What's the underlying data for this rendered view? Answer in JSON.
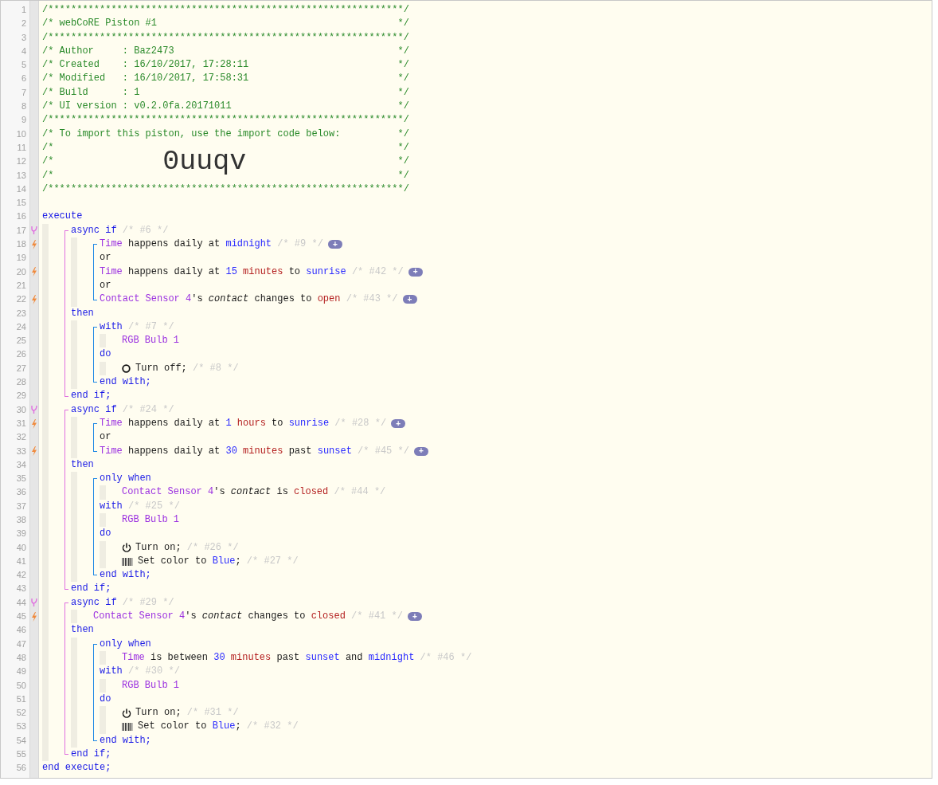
{
  "listing": [
    {
      "kind": "rule",
      "number": "1",
      "text": "/**************************************************************/"
    },
    {
      "kind": "comment",
      "number": "2",
      "text": "/* webCoRE Piston #1",
      "end": "*/"
    },
    {
      "kind": "rule",
      "number": "3",
      "text": "/**************************************************************/"
    },
    {
      "kind": "comment",
      "number": "4",
      "text": "/* Author     : Baz2473",
      "end": "*/"
    },
    {
      "kind": "comment",
      "number": "5",
      "text": "/* Created    : 16/10/2017, 17:28:11",
      "end": "*/"
    },
    {
      "kind": "comment",
      "number": "6",
      "text": "/* Modified   : 16/10/2017, 17:58:31",
      "end": "*/"
    },
    {
      "kind": "comment",
      "number": "7",
      "text": "/* Build      : 1",
      "end": "*/"
    },
    {
      "kind": "comment",
      "number": "8",
      "text": "/* UI version : v0.2.0fa.20171011",
      "end": "*/"
    },
    {
      "kind": "rule",
      "number": "9",
      "text": "/**************************************************************/"
    },
    {
      "kind": "comment",
      "number": "10",
      "text": "/* To import this piston, use the import code below:",
      "end": "*/"
    },
    {
      "kind": "import",
      "numbers": [
        "11",
        "12",
        "13"
      ],
      "left": [
        "/*",
        "/*",
        "/*"
      ],
      "right": [
        "*/",
        "*/",
        "*/"
      ],
      "code": "0uuqv"
    },
    {
      "kind": "rule",
      "number": "14",
      "text": "/**************************************************************/"
    },
    {
      "kind": "line",
      "number": "15"
    },
    {
      "kind": "line",
      "number": "16",
      "tokens": [
        {
          "kind": "keyword",
          "text": "execute"
        }
      ]
    },
    {
      "kind": "indent",
      "items": [
        {
          "kind": "if_block",
          "items": [
            {
              "kind": "branch",
              "number": "17",
              "tokens": [
                {
                  "kind": "keyword",
                  "text": "async if "
                },
                {
                  "kind": "note",
                  "text": "/* #6 */"
                }
              ]
            },
            {
              "kind": "indent",
              "items": [
                {
                  "kind": "list_block",
                  "items": [
                    {
                      "kind": "trigger",
                      "number": "18",
                      "tokens": [
                        {
                          "kind": "device",
                          "text": "Time"
                        },
                        {
                          "kind": "plain",
                          "text": " happens daily at "
                        },
                        {
                          "kind": "constant",
                          "text": "midnight "
                        },
                        {
                          "kind": "note",
                          "text": "/* #9 */"
                        },
                        {
                          "kind": "add",
                          "text": "+"
                        }
                      ]
                    },
                    {
                      "kind": "line",
                      "number": "19",
                      "tokens": [
                        {
                          "kind": "plain",
                          "text": "or"
                        }
                      ]
                    },
                    {
                      "kind": "trigger",
                      "number": "20",
                      "tokens": [
                        {
                          "kind": "device",
                          "text": "Time"
                        },
                        {
                          "kind": "plain",
                          "text": " happens daily at "
                        },
                        {
                          "kind": "number",
                          "text": "15 "
                        },
                        {
                          "kind": "unit",
                          "text": "minutes"
                        },
                        {
                          "kind": "plain",
                          "text": " to "
                        },
                        {
                          "kind": "constant",
                          "text": "sunrise "
                        },
                        {
                          "kind": "note",
                          "text": "/* #42 */"
                        },
                        {
                          "kind": "add",
                          "text": "+"
                        }
                      ]
                    },
                    {
                      "kind": "line",
                      "number": "21",
                      "tokens": [
                        {
                          "kind": "plain",
                          "text": "or"
                        }
                      ]
                    },
                    {
                      "kind": "trigger",
                      "number": "22",
                      "tokens": [
                        {
                          "kind": "device",
                          "text": "Contact Sensor 4"
                        },
                        {
                          "kind": "plain",
                          "text": "'s "
                        },
                        {
                          "kind": "attribute",
                          "text": "contact"
                        },
                        {
                          "kind": "plain",
                          "text": " changes to "
                        },
                        {
                          "kind": "state",
                          "text": "open "
                        },
                        {
                          "kind": "note",
                          "text": "/* #43 */"
                        },
                        {
                          "kind": "add",
                          "text": "+"
                        }
                      ]
                    }
                  ]
                }
              ]
            },
            {
              "kind": "line",
              "number": "23",
              "tokens": [
                {
                  "kind": "keyword",
                  "text": "then"
                }
              ]
            },
            {
              "kind": "indent",
              "items": [
                {
                  "kind": "list_block",
                  "items": [
                    {
                      "kind": "line",
                      "number": "24",
                      "tokens": [
                        {
                          "kind": "keyword",
                          "text": "with "
                        },
                        {
                          "kind": "note",
                          "text": "/* #7 */"
                        }
                      ]
                    },
                    {
                      "kind": "indent",
                      "items": [
                        {
                          "kind": "line",
                          "number": "25",
                          "tokens": [
                            {
                              "kind": "device",
                              "text": "RGB Bulb 1"
                            }
                          ]
                        }
                      ]
                    },
                    {
                      "kind": "line",
                      "number": "26",
                      "tokens": [
                        {
                          "kind": "keyword",
                          "text": "do"
                        }
                      ]
                    },
                    {
                      "kind": "indent",
                      "items": [
                        {
                          "kind": "line",
                          "number": "27",
                          "tokens": [
                            {
                              "kind": "off_icon"
                            },
                            {
                              "kind": "plain",
                              "text": "Turn off; "
                            },
                            {
                              "kind": "note",
                              "text": "/* #8 */"
                            }
                          ]
                        }
                      ]
                    },
                    {
                      "kind": "line",
                      "number": "28",
                      "tokens": [
                        {
                          "kind": "keyword",
                          "text": "end with;"
                        }
                      ]
                    }
                  ]
                }
              ]
            },
            {
              "kind": "line",
              "number": "29",
              "tokens": [
                {
                  "kind": "keyword",
                  "text": "end if;"
                }
              ]
            }
          ]
        },
        {
          "kind": "if_block",
          "items": [
            {
              "kind": "branch",
              "number": "30",
              "tokens": [
                {
                  "kind": "keyword",
                  "text": "async if "
                },
                {
                  "kind": "note",
                  "text": "/* #24 */"
                }
              ]
            },
            {
              "kind": "indent",
              "items": [
                {
                  "kind": "list_block",
                  "items": [
                    {
                      "kind": "trigger",
                      "number": "31",
                      "tokens": [
                        {
                          "kind": "device",
                          "text": "Time"
                        },
                        {
                          "kind": "plain",
                          "text": " happens daily at "
                        },
                        {
                          "kind": "number",
                          "text": "1 "
                        },
                        {
                          "kind": "unit",
                          "text": "hours"
                        },
                        {
                          "kind": "plain",
                          "text": " to "
                        },
                        {
                          "kind": "constant",
                          "text": "sunrise "
                        },
                        {
                          "kind": "note",
                          "text": "/* #28 */"
                        },
                        {
                          "kind": "add",
                          "text": "+"
                        }
                      ]
                    },
                    {
                      "kind": "line",
                      "number": "32",
                      "tokens": [
                        {
                          "kind": "plain",
                          "text": "or"
                        }
                      ]
                    },
                    {
                      "kind": "trigger",
                      "number": "33",
                      "tokens": [
                        {
                          "kind": "device",
                          "text": "Time"
                        },
                        {
                          "kind": "plain",
                          "text": " happens daily at "
                        },
                        {
                          "kind": "number",
                          "text": "30 "
                        },
                        {
                          "kind": "unit",
                          "text": "minutes"
                        },
                        {
                          "kind": "plain",
                          "text": " past "
                        },
                        {
                          "kind": "constant",
                          "text": "sunset "
                        },
                        {
                          "kind": "note",
                          "text": "/* #45 */"
                        },
                        {
                          "kind": "add",
                          "text": "+"
                        }
                      ]
                    }
                  ]
                }
              ]
            },
            {
              "kind": "line",
              "number": "34",
              "tokens": [
                {
                  "kind": "keyword",
                  "text": "then"
                }
              ]
            },
            {
              "kind": "indent",
              "items": [
                {
                  "kind": "list_block",
                  "items": [
                    {
                      "kind": "line",
                      "number": "35",
                      "tokens": [
                        {
                          "kind": "keyword",
                          "text": "only when"
                        }
                      ]
                    },
                    {
                      "kind": "indent",
                      "items": [
                        {
                          "kind": "line",
                          "number": "36",
                          "tokens": [
                            {
                              "kind": "device",
                              "text": "Contact Sensor 4"
                            },
                            {
                              "kind": "plain",
                              "text": "'s "
                            },
                            {
                              "kind": "attribute",
                              "text": "contact"
                            },
                            {
                              "kind": "plain",
                              "text": " is "
                            },
                            {
                              "kind": "state",
                              "text": "closed "
                            },
                            {
                              "kind": "note",
                              "text": "/* #44 */"
                            }
                          ]
                        }
                      ]
                    },
                    {
                      "kind": "line",
                      "number": "37",
                      "tokens": [
                        {
                          "kind": "keyword",
                          "text": "with "
                        },
                        {
                          "kind": "note",
                          "text": "/* #25 */"
                        }
                      ]
                    },
                    {
                      "kind": "indent",
                      "items": [
                        {
                          "kind": "line",
                          "number": "38",
                          "tokens": [
                            {
                              "kind": "device",
                              "text": "RGB Bulb 1"
                            }
                          ]
                        }
                      ]
                    },
                    {
                      "kind": "line",
                      "number": "39",
                      "tokens": [
                        {
                          "kind": "keyword",
                          "text": "do"
                        }
                      ]
                    },
                    {
                      "kind": "indent",
                      "items": [
                        {
                          "kind": "line",
                          "number": "40",
                          "tokens": [
                            {
                              "kind": "on_icon"
                            },
                            {
                              "kind": "plain",
                              "text": "Turn on; "
                            },
                            {
                              "kind": "note",
                              "text": "/* #26 */"
                            }
                          ]
                        },
                        {
                          "kind": "line",
                          "number": "41",
                          "tokens": [
                            {
                              "kind": "color_icon"
                            },
                            {
                              "kind": "plain",
                              "text": "Set color to "
                            },
                            {
                              "kind": "constant",
                              "text": "Blue"
                            },
                            {
                              "kind": "plain",
                              "text": "; "
                            },
                            {
                              "kind": "note",
                              "text": "/* #27 */"
                            }
                          ]
                        }
                      ]
                    },
                    {
                      "kind": "line",
                      "number": "42",
                      "tokens": [
                        {
                          "kind": "keyword",
                          "text": "end with;"
                        }
                      ]
                    }
                  ]
                }
              ]
            },
            {
              "kind": "line",
              "number": "43",
              "tokens": [
                {
                  "kind": "keyword",
                  "text": "end if;"
                }
              ]
            }
          ]
        },
        {
          "kind": "if_block",
          "items": [
            {
              "kind": "branch",
              "number": "44",
              "tokens": [
                {
                  "kind": "keyword",
                  "text": "async if "
                },
                {
                  "kind": "note",
                  "text": "/* #29 */"
                }
              ]
            },
            {
              "kind": "indent",
              "items": [
                {
                  "kind": "trigger",
                  "number": "45",
                  "tokens": [
                    {
                      "kind": "device",
                      "text": "Contact Sensor 4"
                    },
                    {
                      "kind": "plain",
                      "text": "'s "
                    },
                    {
                      "kind": "attribute",
                      "text": "contact"
                    },
                    {
                      "kind": "plain",
                      "text": " changes to "
                    },
                    {
                      "kind": "state",
                      "text": "closed "
                    },
                    {
                      "kind": "note",
                      "text": "/* #41 */"
                    },
                    {
                      "kind": "add",
                      "text": "+"
                    }
                  ]
                }
              ]
            },
            {
              "kind": "line",
              "number": "46",
              "tokens": [
                {
                  "kind": "keyword",
                  "text": "then"
                }
              ]
            },
            {
              "kind": "indent",
              "items": [
                {
                  "kind": "list_block",
                  "items": [
                    {
                      "kind": "line",
                      "number": "47",
                      "tokens": [
                        {
                          "kind": "keyword",
                          "text": "only when"
                        }
                      ]
                    },
                    {
                      "kind": "indent",
                      "items": [
                        {
                          "kind": "line",
                          "number": "48",
                          "tokens": [
                            {
                              "kind": "device",
                              "text": "Time"
                            },
                            {
                              "kind": "plain",
                              "text": " is between "
                            },
                            {
                              "kind": "number",
                              "text": "30 "
                            },
                            {
                              "kind": "unit",
                              "text": "minutes"
                            },
                            {
                              "kind": "plain",
                              "text": " past "
                            },
                            {
                              "kind": "constant",
                              "text": "sunset"
                            },
                            {
                              "kind": "plain",
                              "text": " and "
                            },
                            {
                              "kind": "constant",
                              "text": "midnight "
                            },
                            {
                              "kind": "note",
                              "text": "/* #46 */"
                            }
                          ]
                        }
                      ]
                    },
                    {
                      "kind": "line",
                      "number": "49",
                      "tokens": [
                        {
                          "kind": "keyword",
                          "text": "with "
                        },
                        {
                          "kind": "note",
                          "text": "/* #30 */"
                        }
                      ]
                    },
                    {
                      "kind": "indent",
                      "items": [
                        {
                          "kind": "line",
                          "number": "50",
                          "tokens": [
                            {
                              "kind": "device",
                              "text": "RGB Bulb 1"
                            }
                          ]
                        }
                      ]
                    },
                    {
                      "kind": "line",
                      "number": "51",
                      "tokens": [
                        {
                          "kind": "keyword",
                          "text": "do"
                        }
                      ]
                    },
                    {
                      "kind": "indent",
                      "items": [
                        {
                          "kind": "line",
                          "number": "52",
                          "tokens": [
                            {
                              "kind": "on_icon"
                            },
                            {
                              "kind": "plain",
                              "text": "Turn on; "
                            },
                            {
                              "kind": "note",
                              "text": "/* #31 */"
                            }
                          ]
                        },
                        {
                          "kind": "line",
                          "number": "53",
                          "tokens": [
                            {
                              "kind": "color_icon"
                            },
                            {
                              "kind": "plain",
                              "text": "Set color to "
                            },
                            {
                              "kind": "constant",
                              "text": "Blue"
                            },
                            {
                              "kind": "plain",
                              "text": "; "
                            },
                            {
                              "kind": "note",
                              "text": "/* #32 */"
                            }
                          ]
                        }
                      ]
                    },
                    {
                      "kind": "line",
                      "number": "54",
                      "tokens": [
                        {
                          "kind": "keyword",
                          "text": "end with;"
                        }
                      ]
                    }
                  ]
                }
              ]
            },
            {
              "kind": "line",
              "number": "55",
              "tokens": [
                {
                  "kind": "keyword",
                  "text": "end if;"
                }
              ]
            }
          ]
        }
      ]
    },
    {
      "kind": "line",
      "number": "56",
      "tokens": [
        {
          "kind": "keyword",
          "text": "end execute;"
        }
      ]
    }
  ]
}
